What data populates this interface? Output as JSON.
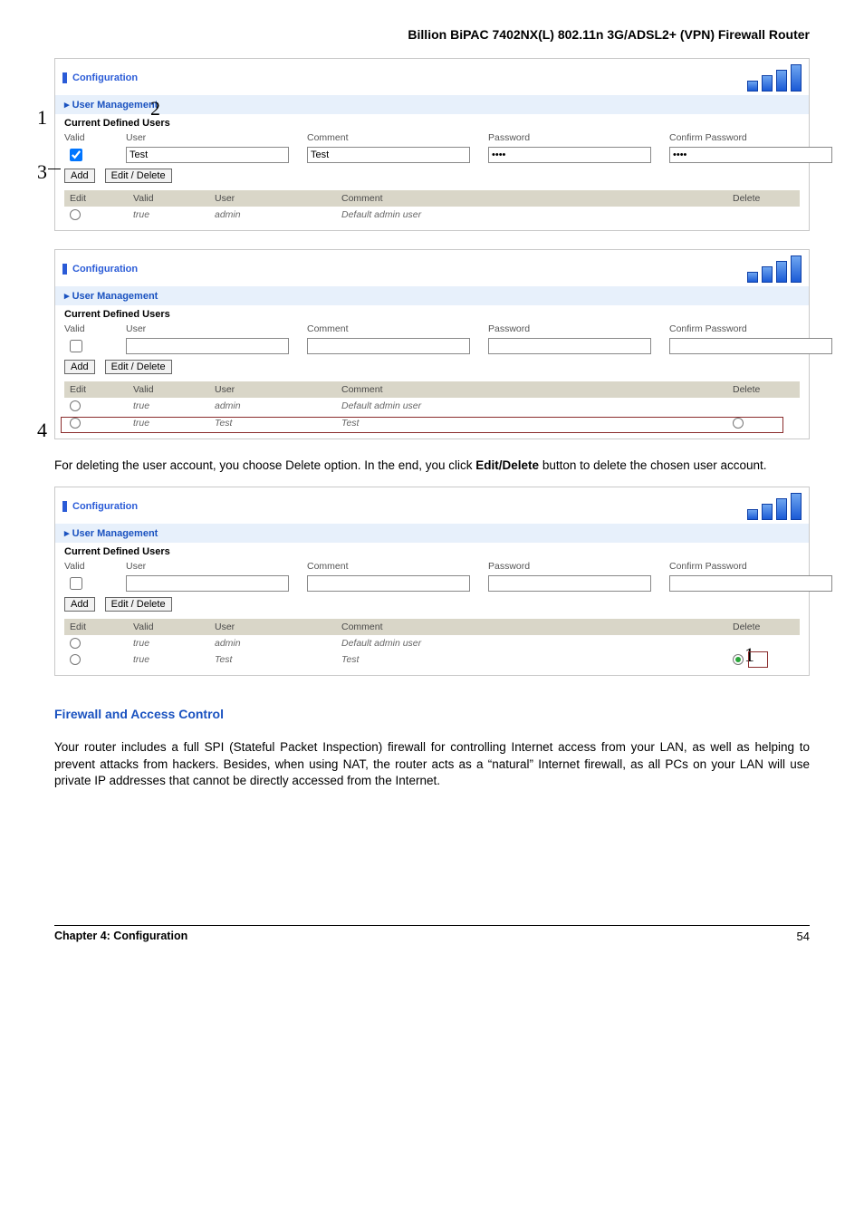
{
  "doc_title": "Billion BiPAC 7402NX(L) 802.11n 3G/ADSL2+ (VPN) Firewall Router",
  "panel_title": "Configuration",
  "section_band": "User Management",
  "sub_head": "Current Defined Users",
  "form_labels": {
    "valid": "Valid",
    "user": "User",
    "comment": "Comment",
    "password": "Password",
    "confirm": "Confirm Password"
  },
  "buttons": {
    "add": "Add",
    "edit_delete": "Edit / Delete"
  },
  "table_headers": {
    "edit": "Edit",
    "valid": "Valid",
    "user": "User",
    "comment": "Comment",
    "delete": "Delete"
  },
  "panels": {
    "a": {
      "checked": true,
      "user": "Test",
      "comment": "Test",
      "password": "••••",
      "confirm": "••••",
      "rows": [
        {
          "edit_on": false,
          "valid": "true",
          "user": "admin",
          "comment": "Default admin user",
          "delete": ""
        }
      ]
    },
    "b": {
      "checked": false,
      "user": "",
      "comment": "",
      "password": "",
      "confirm": "",
      "rows": [
        {
          "edit_on": false,
          "valid": "true",
          "user": "admin",
          "comment": "Default admin user",
          "delete": ""
        },
        {
          "edit_on": false,
          "valid": "true",
          "user": "Test",
          "comment": "Test",
          "delete_radio": true
        }
      ]
    },
    "c": {
      "checked": false,
      "user": "",
      "comment": "",
      "password": "",
      "confirm": "",
      "rows": [
        {
          "edit_on": false,
          "valid": "true",
          "user": "admin",
          "comment": "Default admin user",
          "delete": ""
        },
        {
          "edit_on": false,
          "valid": "true",
          "user": "Test",
          "comment": "Test",
          "delete_radio_on": true
        }
      ]
    }
  },
  "annotations": {
    "n1": "1",
    "n2": "2",
    "n3": "3",
    "n4": "4",
    "c1": "1"
  },
  "body_text": {
    "delete_para_1": "For deleting the user account, you choose Delete option.  In the end, you click ",
    "delete_para_bold": "Edit/Delete",
    "delete_para_2": " button to delete the chosen user account.",
    "firewall_head": "Firewall and Access Control",
    "firewall_para": "Your router includes a full SPI (Stateful Packet Inspection) firewall for controlling Internet access from your LAN, as well as helping to prevent attacks from hackers. Besides, when using NAT, the router acts as a “natural” Internet firewall, as all PCs on your LAN will use private IP addresses that cannot be directly accessed from the Internet."
  },
  "footer": {
    "chapter": "Chapter 4: Configuration",
    "page": "54"
  }
}
